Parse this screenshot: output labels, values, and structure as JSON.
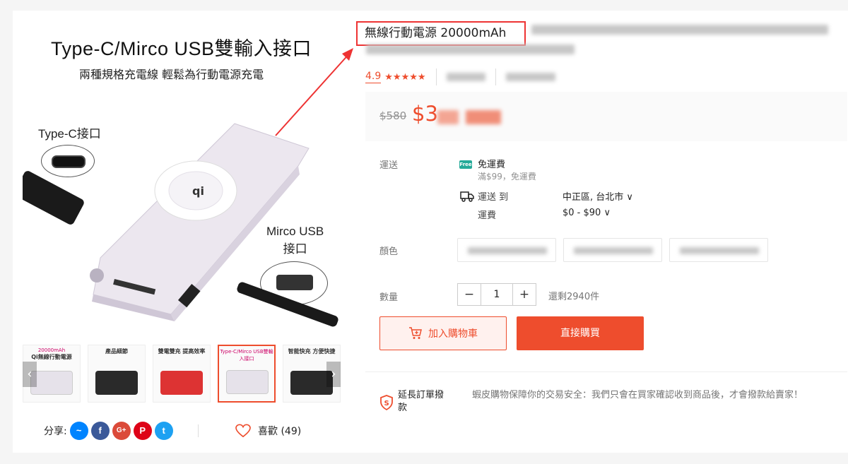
{
  "gallery": {
    "main_image": {
      "title": "Type-C/Mirco USB雙輸入接口",
      "subtitle": "兩種規格充電線 輕鬆為行動電源充電",
      "typec_label": "Type-C接口",
      "micro_label_line1": "Mirco USB",
      "micro_label_line2": "接口"
    },
    "thumbnails": [
      {
        "line1": "20000mAh",
        "line2": "Qi無線行動電源",
        "style": "light"
      },
      {
        "line1": "",
        "line2": "產品細節",
        "style": "dark"
      },
      {
        "line1": "",
        "line2": "雙電雙充 提高效率",
        "style": "red"
      },
      {
        "line1": "Type-C/Mirco USB雙輸入接口",
        "line2": "",
        "style": "light"
      },
      {
        "line1": "",
        "line2": "智能快充 方便快捷",
        "style": "dark"
      }
    ],
    "prev_arrow": "‹",
    "next_arrow": "›"
  },
  "share": {
    "label": "分享:",
    "icons": [
      "messenger-icon",
      "facebook-icon",
      "google-plus-icon",
      "pinterest-icon",
      "twitter-icon"
    ]
  },
  "like": {
    "label": "喜歡 (49)"
  },
  "product": {
    "title": "無線行動電源 20000mAh",
    "rating": "4.9",
    "stars": "★★★★★",
    "old_price": "$580",
    "new_price": "$3"
  },
  "shipping": {
    "label": "運送",
    "free_badge": "Free",
    "free_title": "免運費",
    "free_note": "滿$99，免運費",
    "ship_to_label": "運送 到",
    "ship_to_value": "中正區, 台北市 ∨",
    "fee_label": "運費",
    "fee_value": "$0 - $90 ∨"
  },
  "variation": {
    "label": "顏色"
  },
  "quantity": {
    "label": "數量",
    "minus": "−",
    "value": "1",
    "plus": "+",
    "stock": "還剩2940件"
  },
  "actions": {
    "add_to_cart": "加入購物車",
    "buy_now": "直接購買"
  },
  "guarantee": {
    "title": "延長訂單撥款",
    "text": "蝦皮購物保障你的交易安全：我們只會在買家確認收到商品後，才會撥款給賣家！"
  },
  "colors": {
    "accent": "#ee4d2d",
    "free_badge": "#26aa99",
    "highlight_box": "#e33333"
  }
}
